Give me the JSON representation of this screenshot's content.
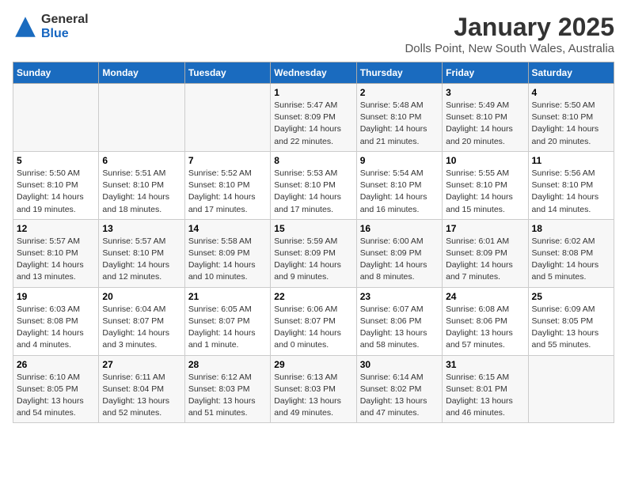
{
  "logo": {
    "general": "General",
    "blue": "Blue"
  },
  "title": "January 2025",
  "subtitle": "Dolls Point, New South Wales, Australia",
  "days_of_week": [
    "Sunday",
    "Monday",
    "Tuesday",
    "Wednesday",
    "Thursday",
    "Friday",
    "Saturday"
  ],
  "weeks": [
    [
      {
        "day": "",
        "info": ""
      },
      {
        "day": "",
        "info": ""
      },
      {
        "day": "",
        "info": ""
      },
      {
        "day": "1",
        "info": "Sunrise: 5:47 AM\nSunset: 8:09 PM\nDaylight: 14 hours\nand 22 minutes."
      },
      {
        "day": "2",
        "info": "Sunrise: 5:48 AM\nSunset: 8:10 PM\nDaylight: 14 hours\nand 21 minutes."
      },
      {
        "day": "3",
        "info": "Sunrise: 5:49 AM\nSunset: 8:10 PM\nDaylight: 14 hours\nand 20 minutes."
      },
      {
        "day": "4",
        "info": "Sunrise: 5:50 AM\nSunset: 8:10 PM\nDaylight: 14 hours\nand 20 minutes."
      }
    ],
    [
      {
        "day": "5",
        "info": "Sunrise: 5:50 AM\nSunset: 8:10 PM\nDaylight: 14 hours\nand 19 minutes."
      },
      {
        "day": "6",
        "info": "Sunrise: 5:51 AM\nSunset: 8:10 PM\nDaylight: 14 hours\nand 18 minutes."
      },
      {
        "day": "7",
        "info": "Sunrise: 5:52 AM\nSunset: 8:10 PM\nDaylight: 14 hours\nand 17 minutes."
      },
      {
        "day": "8",
        "info": "Sunrise: 5:53 AM\nSunset: 8:10 PM\nDaylight: 14 hours\nand 17 minutes."
      },
      {
        "day": "9",
        "info": "Sunrise: 5:54 AM\nSunset: 8:10 PM\nDaylight: 14 hours\nand 16 minutes."
      },
      {
        "day": "10",
        "info": "Sunrise: 5:55 AM\nSunset: 8:10 PM\nDaylight: 14 hours\nand 15 minutes."
      },
      {
        "day": "11",
        "info": "Sunrise: 5:56 AM\nSunset: 8:10 PM\nDaylight: 14 hours\nand 14 minutes."
      }
    ],
    [
      {
        "day": "12",
        "info": "Sunrise: 5:57 AM\nSunset: 8:10 PM\nDaylight: 14 hours\nand 13 minutes."
      },
      {
        "day": "13",
        "info": "Sunrise: 5:57 AM\nSunset: 8:10 PM\nDaylight: 14 hours\nand 12 minutes."
      },
      {
        "day": "14",
        "info": "Sunrise: 5:58 AM\nSunset: 8:09 PM\nDaylight: 14 hours\nand 10 minutes."
      },
      {
        "day": "15",
        "info": "Sunrise: 5:59 AM\nSunset: 8:09 PM\nDaylight: 14 hours\nand 9 minutes."
      },
      {
        "day": "16",
        "info": "Sunrise: 6:00 AM\nSunset: 8:09 PM\nDaylight: 14 hours\nand 8 minutes."
      },
      {
        "day": "17",
        "info": "Sunrise: 6:01 AM\nSunset: 8:09 PM\nDaylight: 14 hours\nand 7 minutes."
      },
      {
        "day": "18",
        "info": "Sunrise: 6:02 AM\nSunset: 8:08 PM\nDaylight: 14 hours\nand 5 minutes."
      }
    ],
    [
      {
        "day": "19",
        "info": "Sunrise: 6:03 AM\nSunset: 8:08 PM\nDaylight: 14 hours\nand 4 minutes."
      },
      {
        "day": "20",
        "info": "Sunrise: 6:04 AM\nSunset: 8:07 PM\nDaylight: 14 hours\nand 3 minutes."
      },
      {
        "day": "21",
        "info": "Sunrise: 6:05 AM\nSunset: 8:07 PM\nDaylight: 14 hours\nand 1 minute."
      },
      {
        "day": "22",
        "info": "Sunrise: 6:06 AM\nSunset: 8:07 PM\nDaylight: 14 hours\nand 0 minutes."
      },
      {
        "day": "23",
        "info": "Sunrise: 6:07 AM\nSunset: 8:06 PM\nDaylight: 13 hours\nand 58 minutes."
      },
      {
        "day": "24",
        "info": "Sunrise: 6:08 AM\nSunset: 8:06 PM\nDaylight: 13 hours\nand 57 minutes."
      },
      {
        "day": "25",
        "info": "Sunrise: 6:09 AM\nSunset: 8:05 PM\nDaylight: 13 hours\nand 55 minutes."
      }
    ],
    [
      {
        "day": "26",
        "info": "Sunrise: 6:10 AM\nSunset: 8:05 PM\nDaylight: 13 hours\nand 54 minutes."
      },
      {
        "day": "27",
        "info": "Sunrise: 6:11 AM\nSunset: 8:04 PM\nDaylight: 13 hours\nand 52 minutes."
      },
      {
        "day": "28",
        "info": "Sunrise: 6:12 AM\nSunset: 8:03 PM\nDaylight: 13 hours\nand 51 minutes."
      },
      {
        "day": "29",
        "info": "Sunrise: 6:13 AM\nSunset: 8:03 PM\nDaylight: 13 hours\nand 49 minutes."
      },
      {
        "day": "30",
        "info": "Sunrise: 6:14 AM\nSunset: 8:02 PM\nDaylight: 13 hours\nand 47 minutes."
      },
      {
        "day": "31",
        "info": "Sunrise: 6:15 AM\nSunset: 8:01 PM\nDaylight: 13 hours\nand 46 minutes."
      },
      {
        "day": "",
        "info": ""
      }
    ]
  ]
}
